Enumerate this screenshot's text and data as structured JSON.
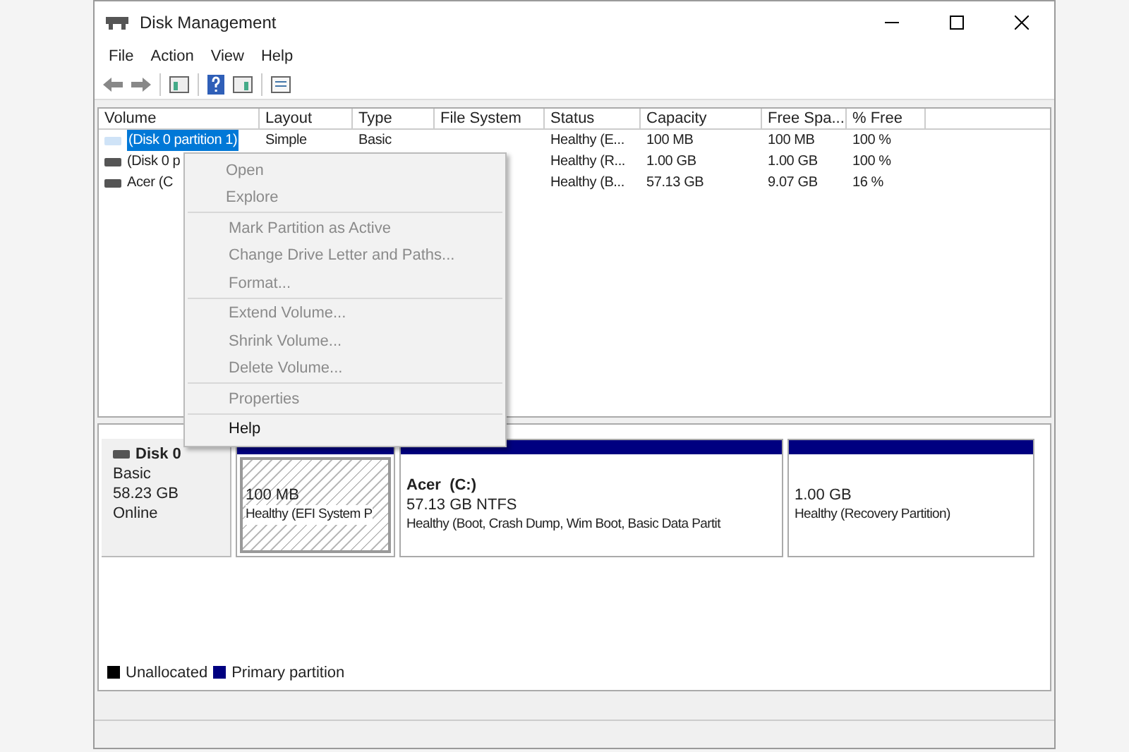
{
  "window": {
    "title": "Disk Management"
  },
  "menu_bar": [
    "File",
    "Action",
    "View",
    "Help"
  ],
  "table": {
    "columns": [
      "Volume",
      "Layout",
      "Type",
      "File System",
      "Status",
      "Capacity",
      "Free Spa...",
      "% Free"
    ],
    "rows": [
      {
        "selected": true,
        "cells": [
          "(Disk 0 partition 1)",
          "Simple",
          "Basic",
          "",
          "Healthy (E...",
          "100 MB",
          "100 MB",
          "100 %"
        ]
      },
      {
        "selected": false,
        "cells": [
          "(Disk 0 p",
          "",
          "",
          "",
          "Healthy (R...",
          "1.00 GB",
          "1.00 GB",
          "100 %"
        ]
      },
      {
        "selected": false,
        "cells": [
          "Acer (C",
          "",
          "",
          "",
          "Healthy (B...",
          "57.13 GB",
          "9.07 GB",
          "16 %"
        ]
      }
    ]
  },
  "context_menu": {
    "groups": [
      [
        {
          "label": "Open",
          "disabled": true
        },
        {
          "label": "Explore",
          "disabled": true
        }
      ],
      [
        {
          "label": "Mark Partition as Active",
          "disabled": true
        },
        {
          "label": "Change Drive Letter and Paths...",
          "disabled": true
        },
        {
          "label": "Format...",
          "disabled": true
        }
      ],
      [
        {
          "label": "Extend Volume...",
          "disabled": true
        },
        {
          "label": "Shrink Volume...",
          "disabled": true
        },
        {
          "label": "Delete Volume...",
          "disabled": true
        }
      ],
      [
        {
          "label": "Properties",
          "disabled": true
        }
      ],
      [
        {
          "label": "Help",
          "disabled": false
        }
      ]
    ]
  },
  "disk": {
    "name": "Disk 0",
    "type": "Basic",
    "size": "58.23 GB",
    "state": "Online",
    "partitions": [
      {
        "selected": true,
        "size": "100 MB",
        "status": "Healthy (EFI System P"
      },
      {
        "selected": false,
        "name": "Acer  (C:)",
        "size": "57.13 GB NTFS",
        "status": "Healthy (Boot, Crash Dump, Wim Boot, Basic Data Partit"
      },
      {
        "selected": false,
        "size": "1.00 GB",
        "status": "Healthy (Recovery Partition)"
      }
    ]
  },
  "legend": [
    {
      "label": "Unallocated",
      "color": "#000000"
    },
    {
      "label": "Primary partition",
      "color": "#000080"
    }
  ]
}
